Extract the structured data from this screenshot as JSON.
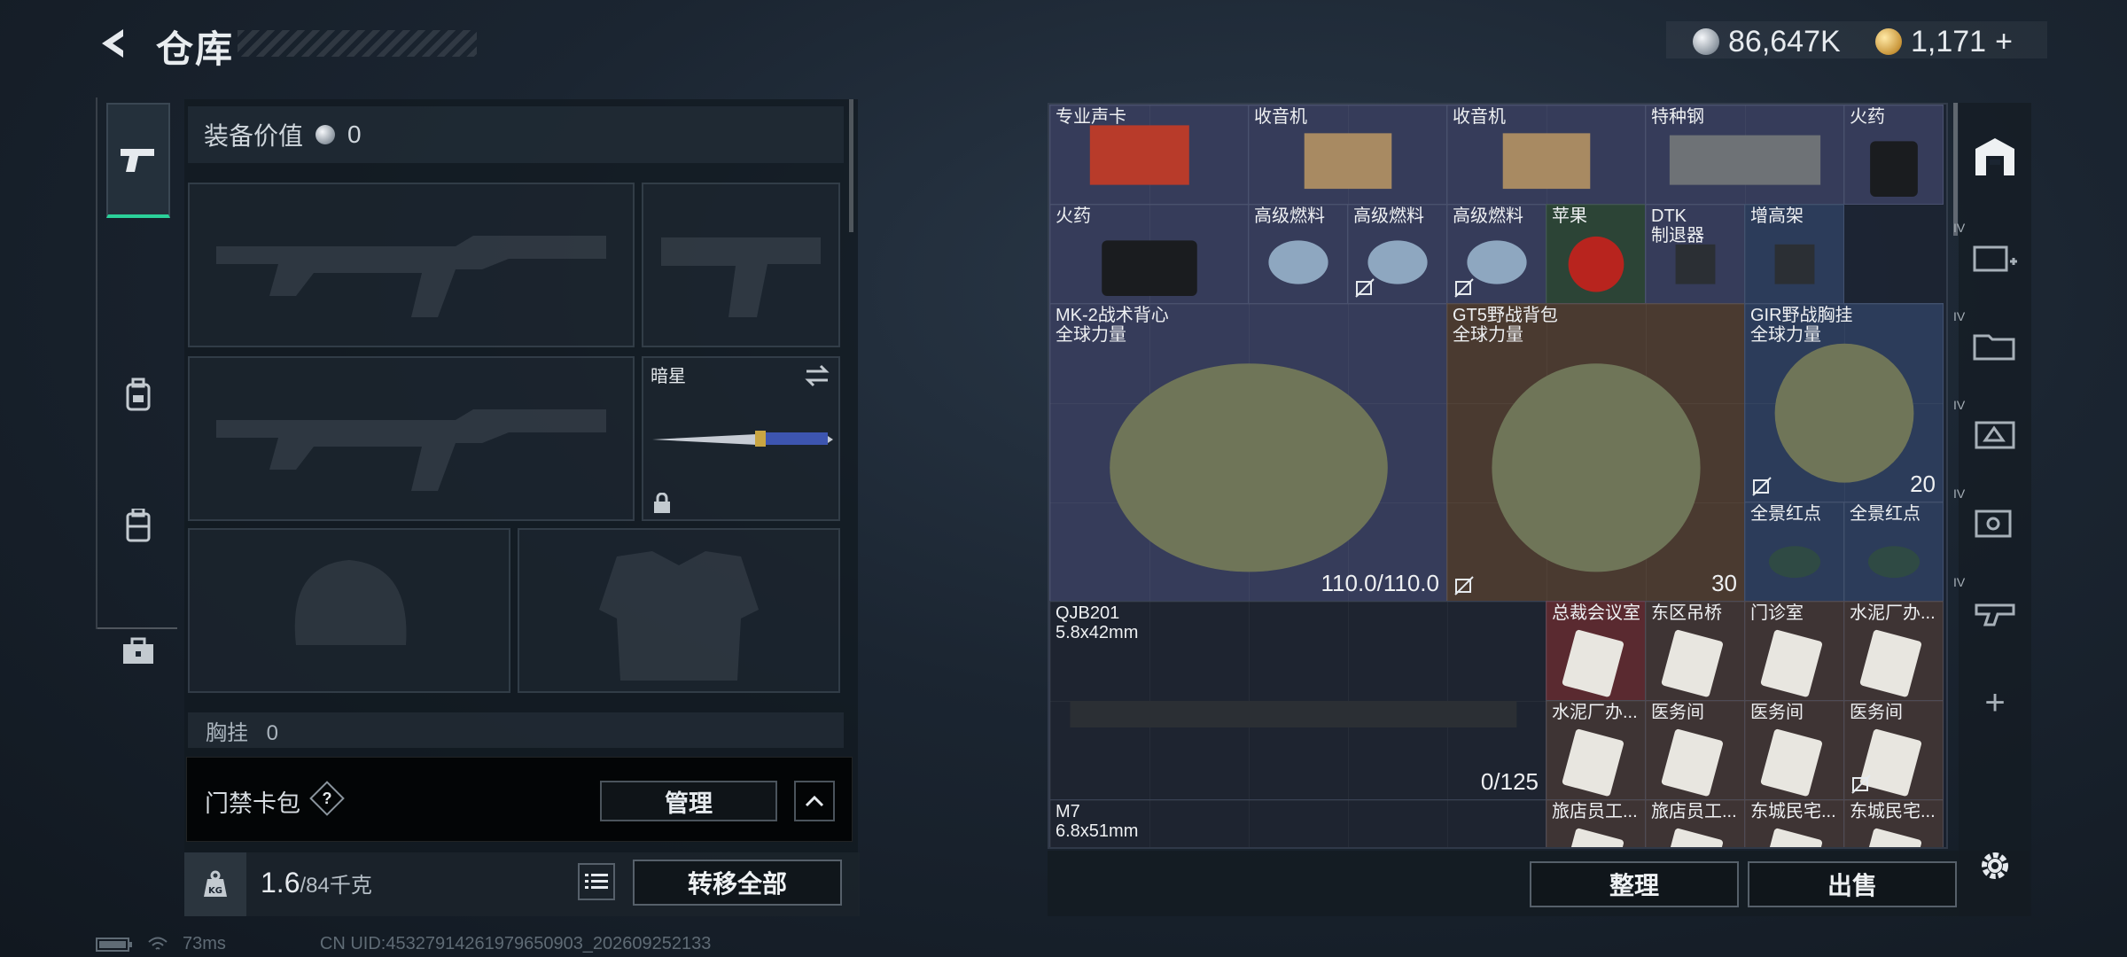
{
  "header": {
    "title": "仓库",
    "silver_amount": "86,647K",
    "gold_amount": "1,171",
    "gold_add": "+"
  },
  "left_panel": {
    "equipment_value_label": "装备价值",
    "equipment_value": "0",
    "melee_slot_name": "暗星",
    "chest_row_label": "胸挂",
    "chest_row_count": "0",
    "card_pack_label": "门禁卡包",
    "card_pack_help": "?",
    "manage_label": "管理",
    "weight_current": "1.6",
    "weight_max": "/84千克",
    "transfer_all_label": "转移全部"
  },
  "status_bar": {
    "ping": "73ms",
    "uid": "CN UID:45327914261979650903_202609252133"
  },
  "grid_items": [
    {
      "name": "专业声卡",
      "qty": "",
      "color": "#363c5a"
    },
    {
      "name": "收音机",
      "qty": "",
      "color": "#363c5a"
    },
    {
      "name": "收音机",
      "qty": "",
      "color": "#363c5a"
    },
    {
      "name": "特种钢",
      "qty": "",
      "color": "#363c5a"
    },
    {
      "name": "火药",
      "qty": "",
      "color": "#363c5a"
    },
    {
      "name": "火药",
      "qty": "",
      "color": "#363c5a"
    },
    {
      "name": "高级燃料",
      "qty": "",
      "color": "#363c5a"
    },
    {
      "name": "高级燃料",
      "qty": "",
      "color": "#363c5a"
    },
    {
      "name": "高级燃料",
      "qty": "",
      "color": "#363c5a"
    },
    {
      "name": "苹果",
      "qty": "",
      "color": "#2c4436"
    },
    {
      "name": "DTK\n制退器",
      "qty": "",
      "color": "#363c5a"
    },
    {
      "name": "增高架",
      "qty": "",
      "color": "#2c3c5a"
    },
    {
      "name": "MK-2战术背心\n全球力量",
      "qty": "110.0/110.0",
      "color": "#363c5a"
    },
    {
      "name": "GT5野战背包\n全球力量",
      "qty": "30",
      "color": "#4a3a30"
    },
    {
      "name": "GIR野战胸挂\n全球力量",
      "qty": "20",
      "color": "#2c3c5a"
    },
    {
      "name": "全景红点",
      "qty": "",
      "color": "#2c3c5a"
    },
    {
      "name": "全景红点",
      "qty": "",
      "color": "#2c3c5a"
    },
    {
      "name": "QJB201\n5.8x42mm",
      "qty": "0/125",
      "color": "#1e2430"
    },
    {
      "name": "总裁会议室",
      "qty": "",
      "color": "#5a2a30"
    },
    {
      "name": "东区吊桥",
      "qty": "",
      "color": "#3e3434"
    },
    {
      "name": "门诊室",
      "qty": "",
      "color": "#3e3434"
    },
    {
      "name": "水泥厂办...",
      "qty": "",
      "color": "#3e3434"
    },
    {
      "name": "水泥厂办...",
      "qty": "",
      "color": "#3e3434"
    },
    {
      "name": "医务间",
      "qty": "",
      "color": "#3e3434"
    },
    {
      "name": "医务间",
      "qty": "",
      "color": "#3e3434"
    },
    {
      "name": "医务间",
      "qty": "",
      "color": "#3e3434"
    },
    {
      "name": "M7\n6.8x51mm",
      "qty": "",
      "color": "#1e2430"
    },
    {
      "name": "旅店员工...",
      "qty": "",
      "color": "#3e3434"
    },
    {
      "name": "旅店员工...",
      "qty": "",
      "color": "#3e3434"
    },
    {
      "name": "东城民宅...",
      "qty": "",
      "color": "#3e3434"
    },
    {
      "name": "东城民宅...",
      "qty": "",
      "color": "#3e3434"
    }
  ],
  "bottom_right": {
    "sort_label": "整理",
    "sell_label": "出售"
  },
  "right_tabs": {
    "tab_labels": [
      "IV",
      "IV",
      "IV",
      "IV",
      "IV"
    ],
    "add_label": "+"
  }
}
